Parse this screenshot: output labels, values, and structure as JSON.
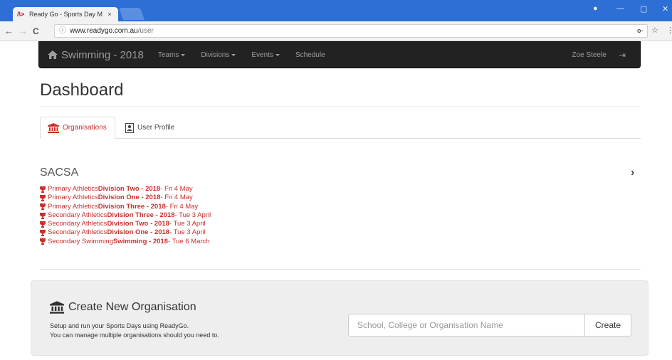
{
  "browser": {
    "tab_title": "Ready Go - Sports Day M",
    "tab_close": "×",
    "favicon_text": "/\\>",
    "url_host": "www.readygo.com.au",
    "url_path": "/user",
    "info_icon": "ⓘ",
    "back_icon": "←",
    "forward_icon": "→",
    "reload_icon": "C",
    "key_icon": "o-",
    "star_icon": "☆",
    "menu_icon": "⋮",
    "profile_icon": "●",
    "minimize_icon": "—",
    "maximize_icon": "▢",
    "close_icon": "✕"
  },
  "navbar": {
    "brand": "Swimming - 2018",
    "items": [
      {
        "label": "Teams",
        "dropdown": true
      },
      {
        "label": "Divisions",
        "dropdown": true
      },
      {
        "label": "Events",
        "dropdown": true
      },
      {
        "label": "Schedule",
        "dropdown": false
      }
    ],
    "user_name": "Zoe Steele",
    "logout_icon": "⇥"
  },
  "page": {
    "title": "Dashboard",
    "tabs": [
      {
        "label": "Organisations",
        "icon": "institution-icon",
        "active": true
      },
      {
        "label": "User Profile",
        "icon": "user-profile-icon",
        "active": false
      }
    ]
  },
  "organisation": {
    "name": "SACSA",
    "chevron": "›",
    "events": [
      {
        "prefix": "Primary Athletics ",
        "name": "Division Two - 2018",
        "date": " - Fri 4 May"
      },
      {
        "prefix": "Primary Athletics ",
        "name": "Division One - 2018",
        "date": " - Fri 4 May"
      },
      {
        "prefix": "Primary Athletics ",
        "name": "Division Three - 2018",
        "date": " - Fri 4 May"
      },
      {
        "prefix": "Secondary Athletics ",
        "name": "Division Three - 2018",
        "date": " - Tue 3 April"
      },
      {
        "prefix": "Secondary Athletics ",
        "name": "Division Two - 2018",
        "date": " - Tue 3 April"
      },
      {
        "prefix": "Secondary Athletics ",
        "name": "Division One - 2018",
        "date": " - Tue 3 April"
      },
      {
        "prefix": "Secondary Swimming ",
        "name": "Swimming - 2018",
        "date": " - Tue 6 March"
      }
    ]
  },
  "create_panel": {
    "title": "Create New Organisation",
    "desc_line1": "Setup and run your Sports Days using ReadyGo.",
    "desc_line2": "You can manage multiple organisations should you need to.",
    "input_placeholder": "School, College or Organisation Name",
    "input_value": "",
    "button_label": "Create"
  },
  "colors": {
    "accent": "#c9302c",
    "navbar_bg": "#222222",
    "chrome_blue": "#2d6fd4"
  }
}
